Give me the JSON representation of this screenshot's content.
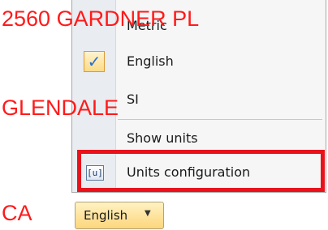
{
  "address": {
    "street": "2560 GARDNER PL",
    "city": "GLENDALE",
    "state": "CA"
  },
  "menu": {
    "items": [
      {
        "label": "Metric"
      },
      {
        "label": "English",
        "checked": true
      },
      {
        "label": "SI"
      },
      {
        "label": "Show units"
      },
      {
        "label": "Units configuration",
        "icon_text": "[u]"
      }
    ]
  },
  "dropdown": {
    "value": "English"
  },
  "colors": {
    "annotation": "#e8121c",
    "address_text": "#ff1a1a",
    "check": "#2a6fd1"
  }
}
